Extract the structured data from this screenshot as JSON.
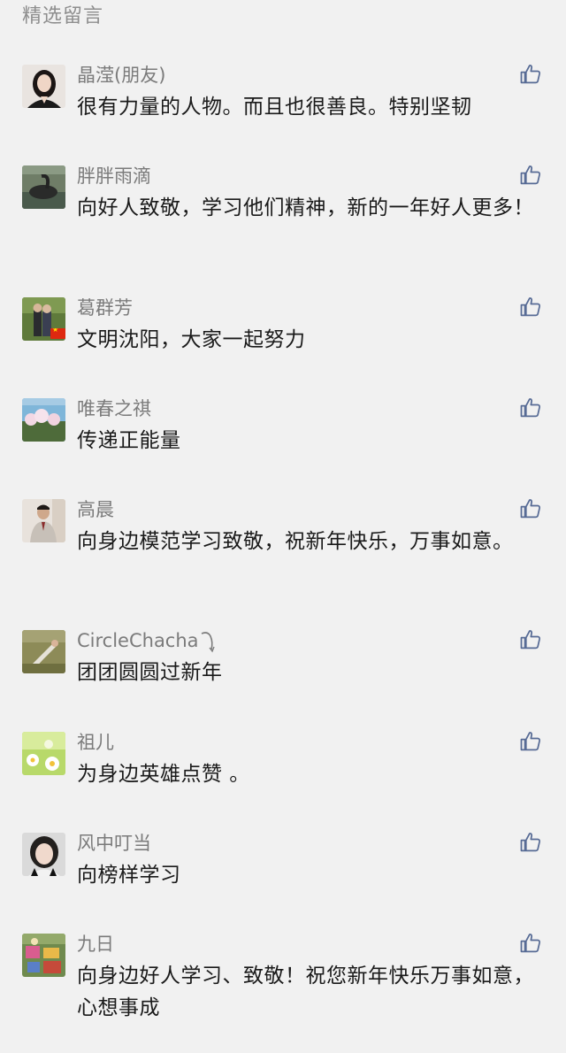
{
  "section_title": "精选留言",
  "like_icon": "thumbs-up-icon",
  "colors": {
    "background": "#f1f1f1",
    "nickname": "#7b7b7b",
    "content": "#1a1a1a",
    "like_icon": "#576b95"
  },
  "comments": [
    {
      "nickname": "晶滢(朋友)",
      "content": "很有力量的人物。而且也很善良。特别坚韧",
      "avatar": "avatar-woman-portrait"
    },
    {
      "nickname": "胖胖雨滴",
      "content": "向好人致敬，学习他们精神，新的一年好人更多！",
      "avatar": "avatar-swan-photo"
    },
    {
      "nickname": "葛群芳",
      "content": "文明沈阳，大家一起努力",
      "avatar": "avatar-couple-photo"
    },
    {
      "nickname": "唯春之祺",
      "content": "传递正能量",
      "avatar": "avatar-blossom-photo"
    },
    {
      "nickname": "高晨",
      "content": "向身边模范学习致敬，祝新年快乐，万事如意。",
      "avatar": "avatar-man-portrait"
    },
    {
      "nickname": "CircleChacha",
      "content": "团团圆圆过新年",
      "avatar": "avatar-figure-grass-photo"
    },
    {
      "nickname": "祖儿",
      "content": "为身边英雄点赞 。",
      "avatar": "avatar-daisy-photo"
    },
    {
      "nickname": "风中叮当",
      "content": "向榜样学习",
      "avatar": "avatar-woman-selfie"
    },
    {
      "nickname": "九日",
      "content": "向身边好人学习、致敬！祝您新年快乐万事如意，心想事成",
      "avatar": "avatar-colorful-photo"
    }
  ]
}
